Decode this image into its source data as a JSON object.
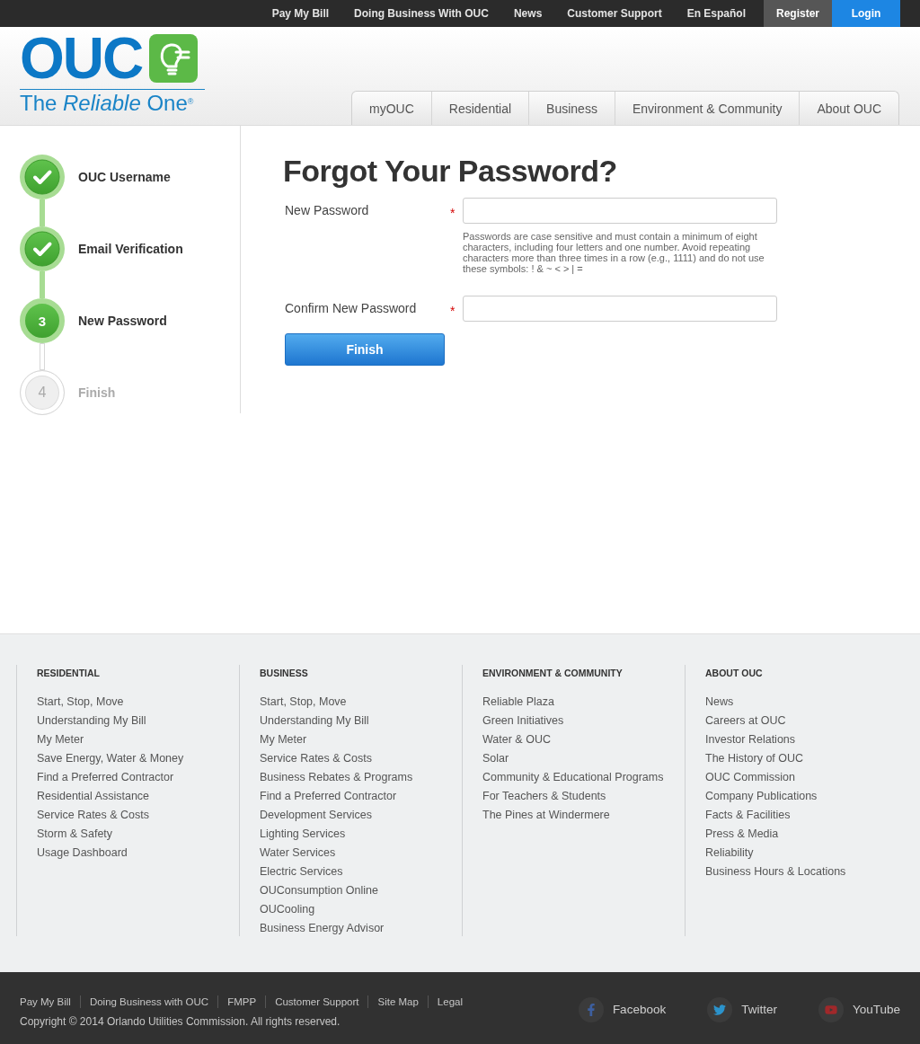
{
  "top_bar": {
    "links": [
      "Pay My Bill",
      "Doing Business With OUC",
      "News",
      "Customer Support",
      "En Español"
    ],
    "account_buttons": [
      {
        "label": "Register",
        "kind": "register"
      },
      {
        "label": "Login",
        "kind": "login"
      }
    ]
  },
  "header": {
    "logo": {
      "wordmark": "OUC",
      "tagline": "The *Reliable* One$^{®}$"
    },
    "nav": [
      "myOUC",
      "Residential",
      "Business",
      "Environment & Community",
      "About OUC"
    ]
  },
  "steps": [
    {
      "label": "OUC Username",
      "completed": true,
      "current": false
    },
    {
      "label": "Email Verification",
      "completed": true,
      "current": false
    },
    {
      "label": "New Password",
      "completed": false,
      "current": true,
      "number": "3"
    },
    {
      "label": "Finish",
      "completed": false,
      "current": false,
      "number": "4"
    }
  ],
  "form": {
    "title": "Forgot Your Password?",
    "fields": [
      {
        "label": "New Password",
        "required_mark": "*",
        "help": "Passwords are case sensitive and must contain a minimum of eight characters, including four letters and one number. Avoid repeating characters more than three times in a row (e.g., 1111) and do not use these symbols: ! & ~ < > | ="
      },
      {
        "label": "Confirm New Password",
        "required_mark": "*"
      }
    ],
    "submit": "Finish"
  },
  "footer": {
    "columns": [
      {
        "heading": "RESIDENTIAL",
        "links": [
          "Start, Stop, Move",
          "Understanding My Bill",
          "My Meter",
          "Save Energy, Water & Money",
          "Find a Preferred Contractor",
          "Residential Assistance",
          "Service Rates & Costs",
          "Storm & Safety",
          "Usage Dashboard"
        ]
      },
      {
        "heading": "BUSINESS",
        "links": [
          "Start, Stop, Move",
          "Understanding My Bill",
          "My Meter",
          "Service Rates & Costs",
          "Business Rebates & Programs",
          "Find a Preferred Contractor",
          "Development Services",
          "Lighting Services",
          "Water Services",
          "Electric Services",
          "OUConsumption Online",
          "OUCooling",
          "Business Energy Advisor"
        ]
      },
      {
        "heading": "ENVIRONMENT & COMMUNITY",
        "links": [
          "Reliable Plaza",
          "Green Initiatives",
          "Water & OUC",
          "Solar",
          "Community & Educational Programs",
          "For Teachers & Students",
          "The Pines at Windermere"
        ]
      },
      {
        "heading": "ABOUT OUC",
        "links": [
          "News",
          "Careers at OUC",
          "Investor Relations",
          "The History of OUC",
          "OUC Commission",
          "Company Publications",
          "Facts & Facilities",
          "Press & Media",
          "Reliability",
          "Business Hours & Locations"
        ]
      }
    ]
  },
  "bottom_bar": {
    "links": [
      "Pay My Bill",
      "Doing Business with OUC",
      "FMPP",
      "Customer Support",
      "Site Map",
      "Legal"
    ],
    "copyright": "Copyright © 2014 Orlando Utilities Commission. All rights reserved.",
    "social": [
      {
        "label": "Facebook",
        "kind": "facebook"
      },
      {
        "label": "Twitter",
        "kind": "twitter"
      },
      {
        "label": "YouTube",
        "kind": "youtube"
      }
    ]
  }
}
